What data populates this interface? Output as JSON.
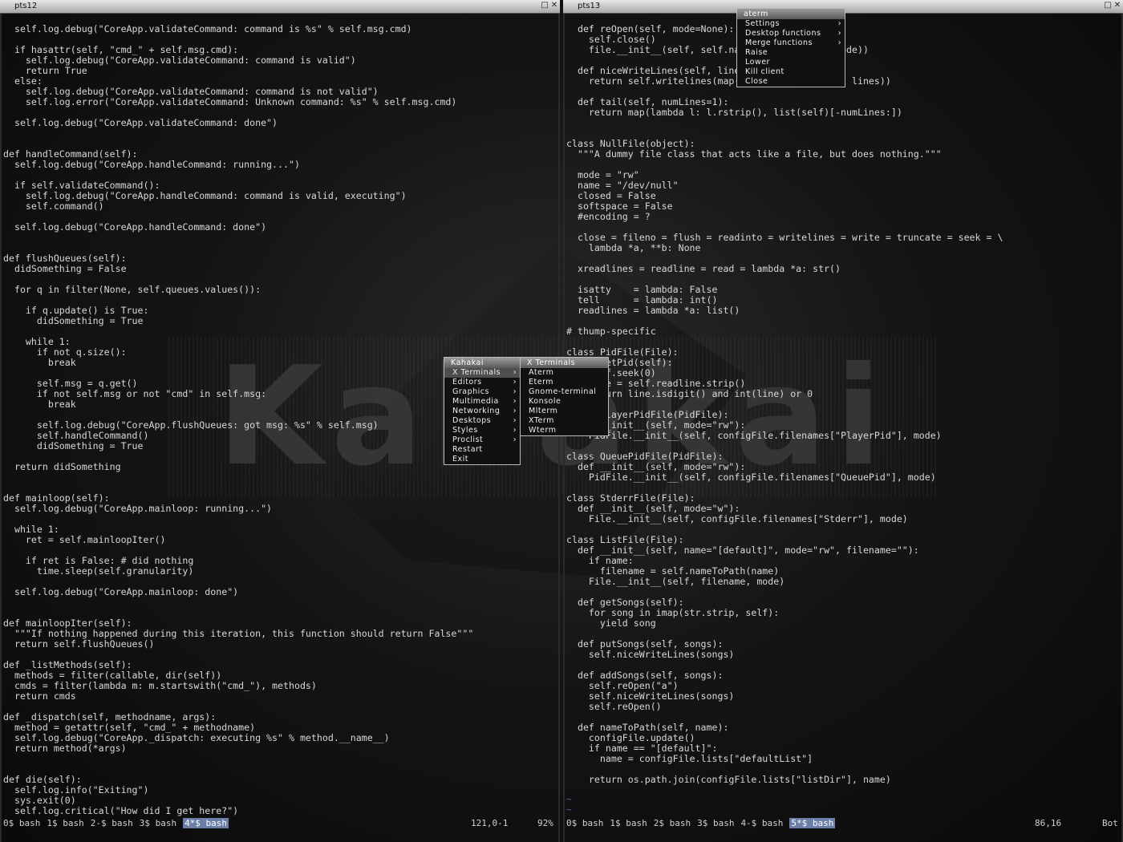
{
  "wallpaper": {
    "text": "Kahakai"
  },
  "left_terminal": {
    "title": "pts12",
    "lines": [
      "  self.log.debug(\"CoreApp.validateCommand: command is %s\" % self.msg.cmd)",
      "",
      "  if hasattr(self, \"cmd_\" + self.msg.cmd):",
      "    self.log.debug(\"CoreApp.validateCommand: command is valid\")",
      "    return True",
      "  else:",
      "    self.log.debug(\"CoreApp.validateCommand: command is not valid\")",
      "    self.log.error(\"CoreApp.validateCommand: Unknown command: %s\" % self.msg.cmd)",
      "",
      "  self.log.debug(\"CoreApp.validateCommand: done\")",
      "",
      "",
      "def handleCommand(self):",
      "  self.log.debug(\"CoreApp.handleCommand: running...\")",
      "",
      "  if self.validateCommand():",
      "    self.log.debug(\"CoreApp.handleCommand: command is valid, executing\")",
      "    self.command()",
      "",
      "  self.log.debug(\"CoreApp.handleCommand: done\")",
      "",
      "",
      "def flushQueues(self):",
      "  didSomething = False",
      "",
      "  for q in filter(None, self.queues.values()):",
      "",
      "    if q.update() is True:",
      "      didSomething = True",
      "",
      "    while 1:",
      "      if not q.size():",
      "        break",
      "",
      "      self.msg = q.get()",
      "      if not self.msg or not \"cmd\" in self.msg:",
      "        break",
      "",
      "      self.log.debug(\"CoreApp.flushQueues: got msg: %s\" % self.msg)",
      "      self.handleCommand()",
      "      didSomething = True",
      "",
      "  return didSomething",
      "",
      "",
      "def mainloop(self):",
      "  self.log.debug(\"CoreApp.mainloop: running...\")",
      "",
      "  while 1:",
      "    ret = self.mainloopIter()",
      "",
      "    if ret is False: # did nothing",
      "      time.sleep(self.granularity)",
      "",
      "  self.log.debug(\"CoreApp.mainloop: done\")",
      "",
      "",
      "def mainloopIter(self):",
      "  \"\"\"If nothing happened during this iteration, this function should return False\"\"\"",
      "  return self.flushQueues()",
      "",
      "def _listMethods(self):",
      "  methods = filter(callable, dir(self))",
      "  cmds = filter(lambda m: m.startswith(\"cmd_\"), methods)",
      "  return cmds",
      "",
      "def _dispatch(self, methodname, args):",
      "  method = getattr(self, \"cmd_\" + methodname)",
      "  self.log.debug(\"CoreApp._dispatch: executing %s\" % method.__name__)",
      "  return method(*args)",
      "",
      "",
      "def die(self):",
      "  self.log.info(\"Exiting\")",
      "  sys.exit(0)",
      "  self.log.critical(\"How did I get here?\")"
    ],
    "tabs": [
      "0$ bash",
      "1$ bash",
      "2-$ bash",
      "3$ bash",
      "4*$ bash"
    ],
    "active_tab": 4,
    "position": "121,0-1",
    "percent": "92%"
  },
  "right_terminal": {
    "title": "pts13",
    "lines": [
      "  def reOpen(self, mode=None):",
      "    self.close()",
      "    file.__init__(self, self.name, mode or self.mode))",
      "",
      "  def niceWriteLines(self, lines):",
      "    return self.writelines(map(lambda l: l + \"\\n\", lines))",
      "",
      "  def tail(self, numLines=1):",
      "    return map(lambda l: l.rstrip(), list(self)[-numLines:])",
      "",
      "",
      "class NullFile(object):",
      "  \"\"\"A dummy file class that acts like a file, but does nothing.\"\"\"",
      "",
      "  mode = \"rw\"",
      "  name = \"/dev/null\"",
      "  closed = False",
      "  softspace = False",
      "  #encoding = ?",
      "",
      "  close = fileno = flush = readinto = writelines = write = truncate = seek = \\",
      "    lambda *a, **b: None",
      "",
      "  xreadlines = readline = read = lambda *a: str()",
      "",
      "  isatty    = lambda: False",
      "  tell      = lambda: int()",
      "  readlines = lambda *a: list()",
      "",
      "# thump-specific",
      "",
      "class PidFile(File):",
      "  def getPid(self):",
      "    self.seek(0)",
      "    line = self.readline.strip()",
      "    return line.isdigit() and int(line) or 0",
      "",
      "class PlayerPidFile(PidFile):",
      "  def __init__(self, mode=\"rw\"):",
      "    PidFile.__init__(self, configFile.filenames[\"PlayerPid\"], mode)",
      "",
      "class QueuePidFile(PidFile):",
      "  def __init__(self, mode=\"rw\"):",
      "    PidFile.__init__(self, configFile.filenames[\"QueuePid\"], mode)",
      "",
      "class StderrFile(File):",
      "  def __init__(self, mode=\"w\"):",
      "    File.__init__(self, configFile.filenames[\"Stderr\"], mode)",
      "",
      "class ListFile(File):",
      "  def __init__(self, name=\"[default]\", mode=\"rw\", filename=\"\"):",
      "    if name:",
      "      filename = self.nameToPath(name)",
      "    File.__init__(self, filename, mode)",
      "",
      "  def getSongs(self):",
      "    for song in imap(str.strip, self):",
      "      yield song",
      "",
      "  def putSongs(self, songs):",
      "    self.niceWriteLines(songs)",
      "",
      "  def addSongs(self, songs):",
      "    self.reOpen(\"a\")",
      "    self.niceWriteLines(songs)",
      "    self.reOpen()",
      "",
      "  def nameToPath(self, name):",
      "    configFile.update()",
      "    if name == \"[default]\":",
      "      name = configFile.lists[\"defaultList\"]",
      "",
      "    return os.path.join(configFile.lists[\"listDir\"], name)"
    ],
    "tilde": "~",
    "tabs": [
      "0$ bash",
      "1$ bash",
      "2$ bash",
      "3$ bash",
      "4-$ bash",
      "5*$ bash"
    ],
    "active_tab": 5,
    "position": "86,16",
    "percent": "Bot"
  },
  "window_menu": {
    "title": "aterm",
    "items": [
      "Settings",
      "Desktop functions",
      "Merge functions",
      "Raise",
      "Lower",
      "Kill client",
      "Close"
    ],
    "submenu_items": [
      0,
      1,
      2
    ]
  },
  "root_menu": {
    "title": "Kahakai",
    "items": [
      "X Terminals",
      "Editors",
      "Graphics",
      "Multimedia",
      "Networking",
      "Desktops",
      "Styles",
      "Proclist",
      "Restart",
      "Exit"
    ],
    "submenu_items": [
      0,
      1,
      2,
      3,
      4,
      5,
      6,
      7
    ],
    "selected": 0
  },
  "terminals_menu": {
    "title": "X Terminals",
    "items": [
      "Aterm",
      "Eterm",
      "Gnome-terminal",
      "Konsole",
      "Mlterm",
      "XTerm",
      "Wterm"
    ]
  },
  "colors": {
    "keyword": "#c8c070",
    "function": "#88aaff",
    "string": "#c8c870",
    "comment": "#7788cc",
    "active_tab": "#6a7ea8"
  }
}
